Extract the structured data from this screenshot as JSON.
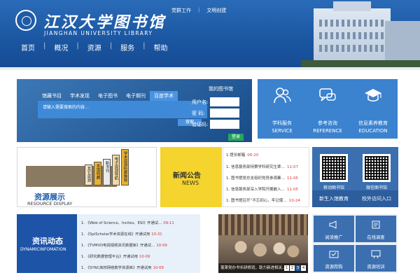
{
  "header": {
    "library_name_cn": "江汉大学图书馆",
    "library_name_en": "JIANGHAN UNIVERSITY LIBRARY",
    "top_links": [
      "党群工作",
      "文明创建"
    ],
    "nav": [
      "首页",
      "概况",
      "资源",
      "服务",
      "帮助"
    ]
  },
  "search": {
    "tabs": [
      "馆藏书目",
      "学术发现",
      "电子图书",
      "电子期刊",
      "百度学术"
    ],
    "active_tab": 4,
    "placeholder": "请输入需要搜索的内容...",
    "search_button": "搜索",
    "my_library": "我的图书馆",
    "username_label": "用户名:",
    "password_label": "密  码:",
    "captcha_label": "验证码:",
    "login_button": "登录"
  },
  "services": [
    {
      "cn": "学科服务",
      "en": "SERVICE",
      "icon": "people-icon"
    },
    {
      "cn": "参考咨询",
      "en": "REFERENCE",
      "icon": "chat-icon"
    },
    {
      "cn": "信息素养教育",
      "en": "EDUCATION",
      "icon": "graduation-cap-icon"
    }
  ],
  "resources": {
    "title": "资源展示",
    "subtitle": "RESOURCE DISPLAY",
    "books": [
      "学术资源检索推荐",
      "电子资源导航",
      "新书刊",
      "本馆特藏",
      "其它资源"
    ]
  },
  "news": {
    "title_cn": "新闻公告",
    "title_en": "NEWS",
    "items": [
      {
        "text": "1.馆长邮箱",
        "date": "06-20"
      },
      {
        "text": "1. 信息服务部持赛学科研究生辈…",
        "date": "11-07"
      },
      {
        "text": "1. 图书馆党总支组织党员参观秦…",
        "date": "11-05"
      },
      {
        "text": "1. 信息服务部深入学院开展嵌入…",
        "date": "11-05"
      },
      {
        "text": "1. 图书馆召开“不忘初心，牢记使…",
        "date": "10-24"
      }
    ]
  },
  "qr": [
    {
      "label": "移动图书馆",
      "sub": "新生入馆教育"
    },
    {
      "label": "微信图书馆",
      "sub": "校外访问入口"
    }
  ],
  "info": {
    "title_cn": "资讯动态",
    "title_en": "DYNAMICINFOMATION",
    "items": [
      {
        "text": "1. 《Web of Science、Incites、ESI》开通试…",
        "date": "09-11"
      },
      {
        "text": "1. 《SpiScholar学术资源在线》开通试用",
        "date": "10-31"
      },
      {
        "text": "1. 《TVMVD电视视频资讯数据库》开通试…",
        "date": "10-09"
      },
      {
        "text": "1. 《研究数据管理平台》开通试用",
        "date": "10-09"
      },
      {
        "text": "1. 《SYNC高校网络数学资源库》开通试用",
        "date": "10-09"
      }
    ]
  },
  "photo": {
    "caption": "蓬莱党办书长研修班，助力新进相关…",
    "pages": [
      "1",
      "2",
      "3",
      "4"
    ],
    "active_page": 2
  },
  "quick_links": [
    {
      "label": "阅读推广",
      "icon": "megaphone-icon"
    },
    {
      "label": "在线调查",
      "icon": "survey-icon"
    },
    {
      "label": "资源荐购",
      "icon": "recommend-icon"
    },
    {
      "label": "资源培训",
      "icon": "training-icon"
    }
  ],
  "colors": {
    "primary": "#1e5ca7",
    "tile": "#3b82cf",
    "news_yellow": "#f4d42d",
    "date_red": "#d33333"
  }
}
